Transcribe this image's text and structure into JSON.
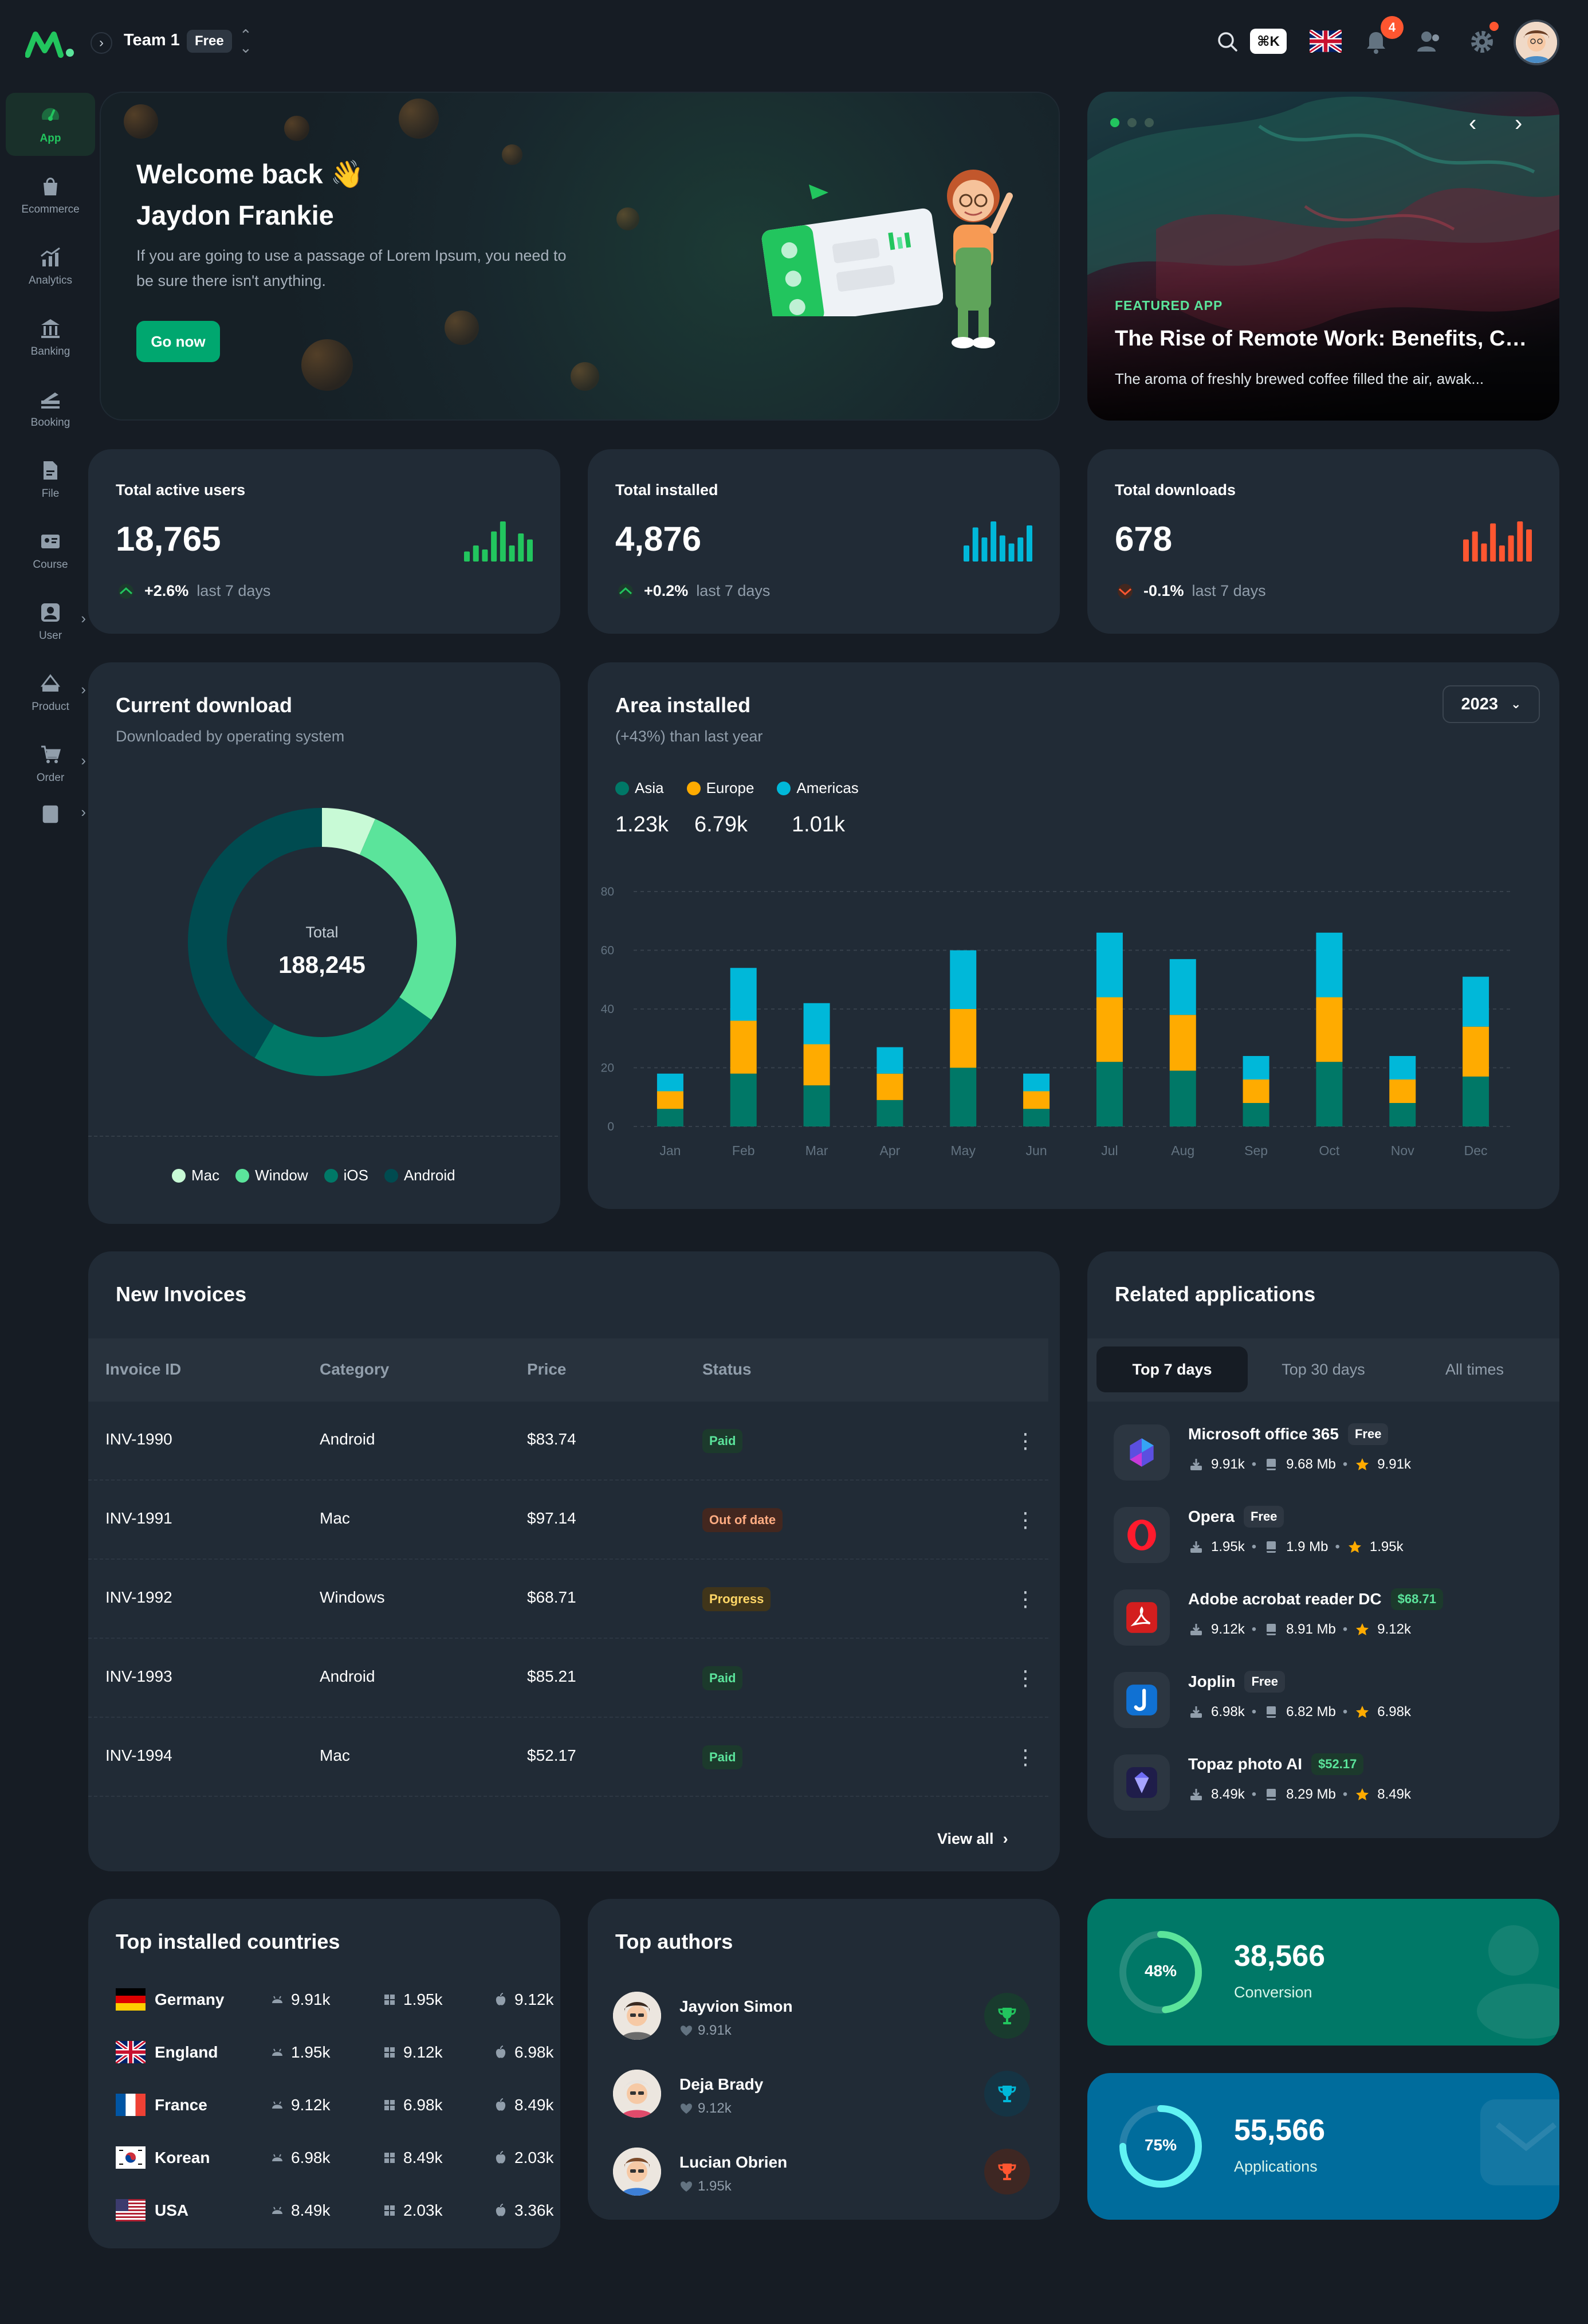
{
  "header": {
    "team_name": "Team 1",
    "team_plan": "Free",
    "kbd_shortcut": "⌘K",
    "notification_count": "4"
  },
  "sidebar": {
    "items": [
      {
        "label": "App",
        "icon": "speedometer-icon",
        "active": true
      },
      {
        "label": "Ecommerce",
        "icon": "bag-icon"
      },
      {
        "label": "Analytics",
        "icon": "analytics-icon"
      },
      {
        "label": "Banking",
        "icon": "bank-icon"
      },
      {
        "label": "Booking",
        "icon": "booking-icon"
      },
      {
        "label": "File",
        "icon": "file-icon"
      },
      {
        "label": "Course",
        "icon": "course-icon"
      },
      {
        "label": "User",
        "icon": "user-icon"
      },
      {
        "label": "Product",
        "icon": "product-icon"
      },
      {
        "label": "Order",
        "icon": "cart-icon"
      }
    ]
  },
  "welcome": {
    "title_line1": "Welcome back 👋",
    "title_line2": "Jaydon Frankie",
    "subtitle": "If you are going to use a passage of Lorem Ipsum, you need to be sure there isn't anything.",
    "button": "Go now"
  },
  "featured": {
    "tag": "FEATURED APP",
    "title": "The Rise of Remote Work: Benefits, Ch...",
    "description": "The aroma of freshly brewed coffee filled the air, awak..."
  },
  "stats": [
    {
      "label": "Total active users",
      "value": "18,765",
      "change": "+2.6%",
      "period": "last 7 days",
      "direction": "up",
      "color": "#22c55e",
      "bars": [
        0.25,
        0.4,
        0.3,
        0.75,
        1,
        0.4,
        0.7,
        0.55
      ]
    },
    {
      "label": "Total installed",
      "value": "4,876",
      "change": "+0.2%",
      "period": "last 7 days",
      "direction": "up",
      "color": "#00b8d9",
      "bars": [
        0.4,
        0.85,
        0.6,
        1,
        0.65,
        0.45,
        0.6,
        0.9
      ]
    },
    {
      "label": "Total downloads",
      "value": "678",
      "change": "-0.1%",
      "period": "last 7 days",
      "direction": "down",
      "color": "#ff5630",
      "bars": [
        0.55,
        0.75,
        0.45,
        0.95,
        0.4,
        0.65,
        1,
        0.8
      ]
    }
  ],
  "current_download": {
    "title": "Current download",
    "subtitle": "Downloaded by operating system",
    "total_label": "Total",
    "total_value": "188,245",
    "segments": [
      {
        "name": "Mac",
        "value": 12244,
        "color": "#c8fad6"
      },
      {
        "name": "Window",
        "value": 53345,
        "color": "#5be49b"
      },
      {
        "name": "iOS",
        "value": 44313,
        "color": "#007867"
      },
      {
        "name": "Android",
        "value": 78343,
        "color": "#004b50"
      }
    ]
  },
  "area_installed": {
    "title": "Area installed",
    "subtitle": "(+43%) than last year",
    "year": "2023",
    "regions": [
      {
        "name": "Asia",
        "value": "1.23k",
        "color": "#007867"
      },
      {
        "name": "Europe",
        "value": "6.79k",
        "color": "#ffab00"
      },
      {
        "name": "Americas",
        "value": "1.01k",
        "color": "#00b8d9"
      }
    ]
  },
  "chart_data": {
    "type": "bar",
    "stacked": true,
    "categories": [
      "Jan",
      "Feb",
      "Mar",
      "Apr",
      "May",
      "Jun",
      "Jul",
      "Aug",
      "Sep",
      "Oct",
      "Nov",
      "Dec"
    ],
    "series": [
      {
        "name": "Asia",
        "color": "#007867",
        "values": [
          6,
          18,
          14,
          9,
          20,
          6,
          22,
          19,
          8,
          22,
          8,
          17
        ]
      },
      {
        "name": "Europe",
        "color": "#ffab00",
        "values": [
          6,
          18,
          14,
          9,
          20,
          6,
          22,
          19,
          8,
          22,
          8,
          17
        ]
      },
      {
        "name": "Americas",
        "color": "#00b8d9",
        "values": [
          6,
          18,
          14,
          9,
          20,
          6,
          22,
          19,
          8,
          22,
          8,
          17
        ]
      }
    ],
    "ylim": [
      0,
      80
    ],
    "yticks": [
      0,
      20,
      40,
      60,
      80
    ],
    "grid": true
  },
  "invoices": {
    "title": "New Invoices",
    "headers": [
      "Invoice ID",
      "Category",
      "Price",
      "Status"
    ],
    "rows": [
      {
        "id": "INV-1990",
        "category": "Android",
        "price": "$83.74",
        "status": "Paid",
        "status_type": "paid"
      },
      {
        "id": "INV-1991",
        "category": "Mac",
        "price": "$97.14",
        "status": "Out of date",
        "status_type": "out"
      },
      {
        "id": "INV-1992",
        "category": "Windows",
        "price": "$68.71",
        "status": "Progress",
        "status_type": "progress"
      },
      {
        "id": "INV-1993",
        "category": "Android",
        "price": "$85.21",
        "status": "Paid",
        "status_type": "paid"
      },
      {
        "id": "INV-1994",
        "category": "Mac",
        "price": "$52.17",
        "status": "Paid",
        "status_type": "paid"
      }
    ],
    "view_all": "View all"
  },
  "related_apps": {
    "title": "Related applications",
    "tabs": [
      "Top 7 days",
      "Top 30 days",
      "All times"
    ],
    "apps": [
      {
        "name": "Microsoft office 365",
        "badge": "Free",
        "badge_type": "free",
        "downloads": "9.91k",
        "size": "9.68 Mb",
        "rating": "9.91k",
        "icon": "office-icon"
      },
      {
        "name": "Opera",
        "badge": "Free",
        "badge_type": "free",
        "downloads": "1.95k",
        "size": "1.9 Mb",
        "rating": "1.95k",
        "icon": "opera-icon"
      },
      {
        "name": "Adobe acrobat reader DC",
        "badge": "$68.71",
        "badge_type": "paid",
        "downloads": "9.12k",
        "size": "8.91 Mb",
        "rating": "9.12k",
        "icon": "acrobat-icon"
      },
      {
        "name": "Joplin",
        "badge": "Free",
        "badge_type": "free",
        "downloads": "6.98k",
        "size": "6.82 Mb",
        "rating": "6.98k",
        "icon": "joplin-icon"
      },
      {
        "name": "Topaz photo AI",
        "badge": "$52.17",
        "badge_type": "paid",
        "downloads": "8.49k",
        "size": "8.29 Mb",
        "rating": "8.49k",
        "icon": "topaz-icon"
      }
    ]
  },
  "countries": {
    "title": "Top installed countries",
    "rows": [
      {
        "name": "Germany",
        "android": "9.91k",
        "windows": "1.95k",
        "apple": "9.12k",
        "flag": "germany-flag-icon"
      },
      {
        "name": "England",
        "android": "1.95k",
        "windows": "9.12k",
        "apple": "6.98k",
        "flag": "uk-flag-icon"
      },
      {
        "name": "France",
        "android": "9.12k",
        "windows": "6.98k",
        "apple": "8.49k",
        "flag": "france-flag-icon"
      },
      {
        "name": "Korean",
        "android": "6.98k",
        "windows": "8.49k",
        "apple": "2.03k",
        "flag": "korea-flag-icon"
      },
      {
        "name": "USA",
        "android": "8.49k",
        "windows": "2.03k",
        "apple": "3.36k",
        "flag": "usa-flag-icon"
      }
    ]
  },
  "authors": {
    "title": "Top authors",
    "rows": [
      {
        "name": "Jayvion Simon",
        "likes": "9.91k",
        "trophy_color": "#22c55e",
        "trophy_bg": "#193b2e"
      },
      {
        "name": "Deja Brady",
        "likes": "9.12k",
        "trophy_color": "#00b8d9",
        "trophy_bg": "#153444"
      },
      {
        "name": "Lucian Obrien",
        "likes": "1.95k",
        "trophy_color": "#ff5630",
        "trophy_bg": "#3e2723"
      }
    ]
  },
  "widgets": [
    {
      "percent": "48%",
      "progress": 0.48,
      "value": "38,566",
      "label": "Conversion",
      "bg": "#007867",
      "ring": "#5be49b"
    },
    {
      "percent": "75%",
      "progress": 0.75,
      "value": "55,566",
      "label": "Applications",
      "bg": "#006c9c",
      "ring": "#61f3f3"
    }
  ]
}
